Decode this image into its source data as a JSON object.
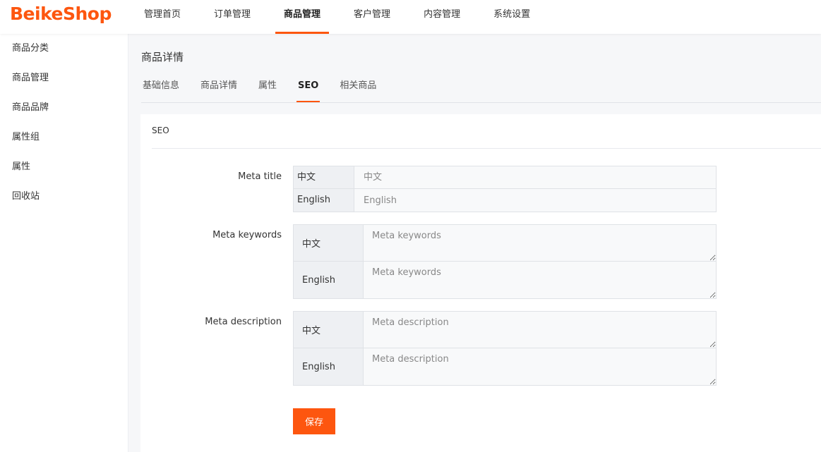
{
  "header": {
    "logo": "BeikeShop",
    "nav": [
      {
        "label": "管理首页"
      },
      {
        "label": "订单管理"
      },
      {
        "label": "商品管理",
        "active": true
      },
      {
        "label": "客户管理"
      },
      {
        "label": "内容管理"
      },
      {
        "label": "系统设置"
      }
    ]
  },
  "sidebar": {
    "items": [
      {
        "label": "商品分类"
      },
      {
        "label": "商品管理"
      },
      {
        "label": "商品品牌"
      },
      {
        "label": "属性组"
      },
      {
        "label": "属性"
      },
      {
        "label": "回收站"
      }
    ]
  },
  "main": {
    "page_title": "商品详情",
    "tabs": [
      {
        "label": "基础信息"
      },
      {
        "label": "商品详情"
      },
      {
        "label": "属性"
      },
      {
        "label": "SEO",
        "active": true
      },
      {
        "label": "相关商品"
      }
    ],
    "card": {
      "title": "SEO",
      "meta_title": {
        "label": "Meta title",
        "fields": [
          {
            "lang": "中文",
            "value": "",
            "placeholder": "中文"
          },
          {
            "lang": "English",
            "value": "",
            "placeholder": "English"
          }
        ]
      },
      "meta_keywords": {
        "label": "Meta keywords",
        "fields": [
          {
            "lang": "中文",
            "value": "",
            "placeholder": "Meta keywords"
          },
          {
            "lang": "English",
            "value": "",
            "placeholder": "Meta keywords"
          }
        ]
      },
      "meta_description": {
        "label": "Meta description",
        "fields": [
          {
            "lang": "中文",
            "value": "",
            "placeholder": "Meta description"
          },
          {
            "lang": "English",
            "value": "",
            "placeholder": "Meta description"
          }
        ]
      },
      "save_label": "保存"
    }
  },
  "colors": {
    "accent": "#fd560f",
    "background": "#f6f7f9",
    "prefix_bg": "#eef0f3"
  }
}
